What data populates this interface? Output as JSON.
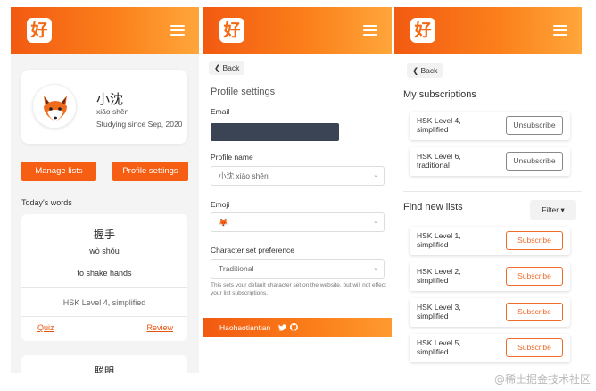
{
  "logo": {
    "glyph": "好"
  },
  "profile": {
    "name_zh": "小沈",
    "name_pinyin": "xiǎo shěn",
    "since": "Studying since Sep, 2020",
    "emoji": "🦊"
  },
  "home": {
    "manage_lists": "Manage lists",
    "profile_settings": "Profile settings",
    "todays_words": "Today's words",
    "words": [
      {
        "hanzi": "握手",
        "pinyin": "wò shǒu",
        "definition": "to shake hands",
        "list": "HSK Level 4, simplified",
        "quiz": "Quiz",
        "review": "Review"
      },
      {
        "hanzi": "聪明"
      }
    ]
  },
  "settings": {
    "back": "Back",
    "title": "Profile settings",
    "email_label": "Email",
    "profile_name_label": "Profile name",
    "profile_name_value": "小沈 xiǎo shěn",
    "emoji_label": "Emoji",
    "emoji_value": "🦊",
    "charset_label": "Character set preference",
    "charset_value": "Traditional",
    "help_text": "This sets your default character set on the website, but will not effect your list subscriptions.",
    "footer": "Haohaotiantian"
  },
  "subscriptions": {
    "back": "Back",
    "my_title": "My subscriptions",
    "my": [
      {
        "label": "HSK Level 4, simplified",
        "action": "Unsubscribe"
      },
      {
        "label": "HSK Level 6, traditional",
        "action": "Unsubscribe"
      }
    ],
    "find_title": "Find new lists",
    "filter": "Filter",
    "find": [
      {
        "label": "HSK Level 1, simplified",
        "action": "Subscribe"
      },
      {
        "label": "HSK Level 2, simplified",
        "action": "Subscribe"
      },
      {
        "label": "HSK Level 3, simplified",
        "action": "Subscribe"
      },
      {
        "label": "HSK Level 5, simplified",
        "action": "Subscribe"
      }
    ]
  },
  "watermark": "@稀土掘金技术社区",
  "colors": {
    "brand": "#f65e13",
    "brand_light": "#ffa63a"
  }
}
